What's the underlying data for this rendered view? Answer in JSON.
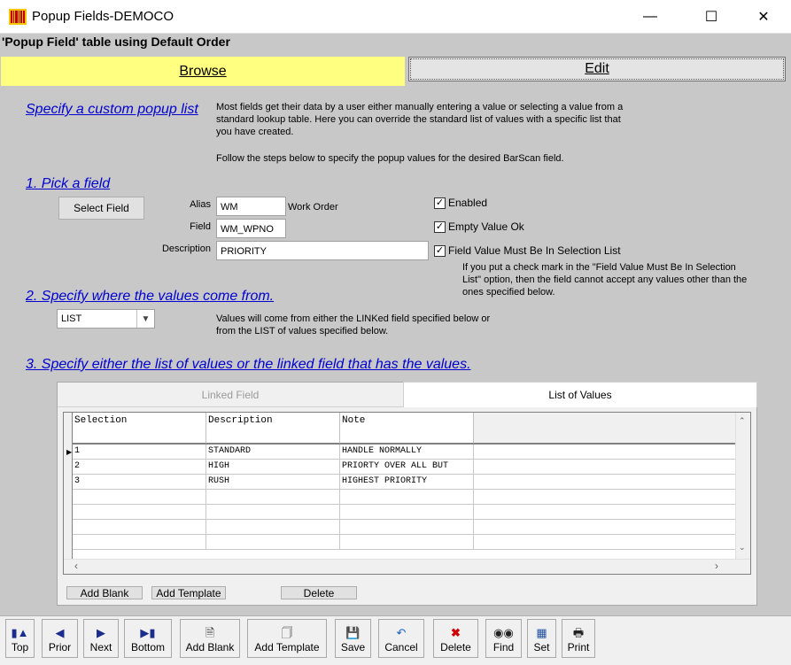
{
  "window": {
    "title": "Popup Fields-DEMOCO"
  },
  "subtitle": "'Popup Field' table using Default Order",
  "tabs": {
    "browse": "Browse",
    "edit": "Edit"
  },
  "intro": {
    "link": "Specify a custom popup list",
    "text1": "Most fields get their data by a user either manually entering a value or selecting a value from a standard lookup table. Here you can override the standard list of values with a specific list that you have created.",
    "text2": "Follow the steps below to specify the popup values for the desired BarScan field."
  },
  "step1": {
    "link": "1. Pick a field",
    "select_field_button": "Select Field",
    "alias_label": "Alias",
    "alias_value": "WM",
    "alias_desc": "Work Order",
    "field_label": "Field",
    "field_value": "WM_WPNO",
    "description_label": "Description",
    "description_value": "PRIORITY",
    "enabled_label": "Enabled",
    "empty_ok_label": "Empty Value Ok",
    "must_be_in_list_label": "Field Value Must Be In Selection List",
    "must_be_in_list_note": "If you put a check mark in the \"Field Value Must Be In Selection List\" option, then the field cannot accept any values other than the ones specified below."
  },
  "step2": {
    "link": "2. Specify where the values come from.",
    "source_value": "LIST",
    "note": "Values will come from either the LINKed field specified below or from the LIST of values specified below."
  },
  "step3": {
    "link": "3. Specify either the list of values or the linked field that has the values.",
    "tab_linked": "Linked Field",
    "tab_list": "List of Values",
    "columns": [
      "Selection",
      "Description",
      "Note"
    ],
    "rows": [
      [
        "1",
        "STANDARD",
        "HANDLE NORMALLY"
      ],
      [
        "2",
        "HIGH",
        "PRIORTY OVER ALL BUT"
      ],
      [
        "3",
        "RUSH",
        "HIGHEST PRIORITY"
      ]
    ],
    "add_blank": "Add Blank",
    "add_template": "Add Template",
    "delete": "Delete"
  },
  "toolbar": {
    "top": "Top",
    "prior": "Prior",
    "next": "Next",
    "bottom": "Bottom",
    "add_blank": "Add Blank",
    "add_template": "Add Template",
    "save": "Save",
    "cancel": "Cancel",
    "delete": "Delete",
    "find": "Find",
    "set": "Set",
    "print": "Print"
  }
}
